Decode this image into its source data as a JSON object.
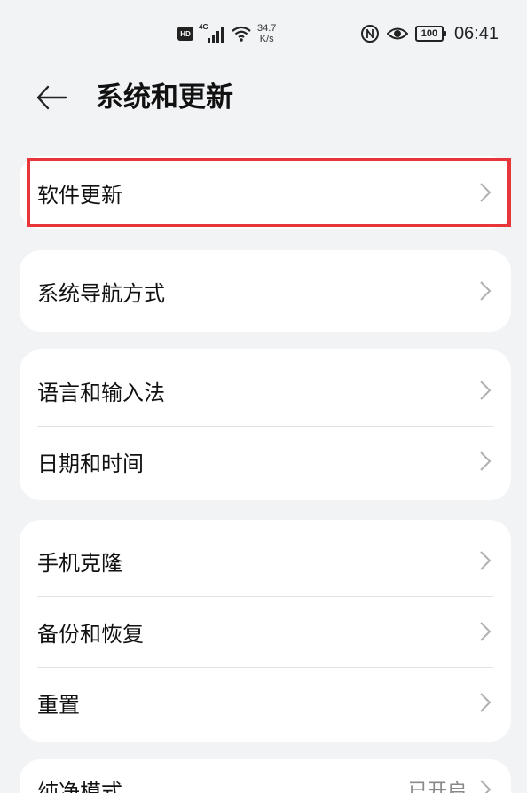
{
  "status_bar": {
    "hd_label": "HD",
    "network_label": "4G",
    "speed_value": "34.7",
    "speed_unit": "K/s",
    "battery_level": "100",
    "time": "06:41",
    "icons": [
      "hd-icon",
      "signal-icon",
      "wifi-icon",
      "nfc-icon",
      "eye-comfort-icon",
      "battery-icon"
    ]
  },
  "header": {
    "title": "系统和更新",
    "back_icon": "back-arrow-icon"
  },
  "groups": [
    {
      "items": [
        {
          "label": "软件更新",
          "highlighted": true
        }
      ]
    },
    {
      "items": [
        {
          "label": "系统导航方式"
        }
      ]
    },
    {
      "items": [
        {
          "label": "语言和输入法"
        },
        {
          "label": "日期和时间"
        }
      ]
    },
    {
      "items": [
        {
          "label": "手机克隆"
        },
        {
          "label": "备份和恢复"
        },
        {
          "label": "重置"
        }
      ]
    },
    {
      "items": [
        {
          "label": "纯净模式",
          "value": "已开启"
        }
      ]
    }
  ],
  "colors": {
    "background": "#f1f3f5",
    "card": "#ffffff",
    "highlight_border": "#e8353a",
    "chevron": "#b0b0b0"
  }
}
